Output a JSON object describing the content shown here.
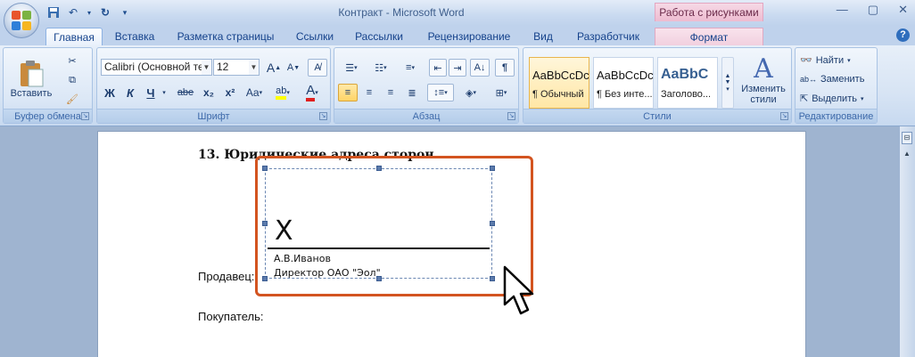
{
  "window": {
    "title": "Контракт - Microsoft Word",
    "contextual_header": "Работа с рисунками"
  },
  "tabs": [
    "Главная",
    "Вставка",
    "Разметка страницы",
    "Ссылки",
    "Рассылки",
    "Рецензирование",
    "Вид",
    "Разработчик",
    "Формат"
  ],
  "ribbon": {
    "clipboard": {
      "paste_label": "Вставить",
      "group_label": "Буфер обмена"
    },
    "font": {
      "font_name": "Calibri (Основной те",
      "font_size": "12",
      "bold": "Ж",
      "italic": "К",
      "underline": "Ч",
      "strike": "abe",
      "subscript": "x₂",
      "superscript": "x²",
      "case": "Aa",
      "grow": "A",
      "shrink": "A",
      "highlight": "ab",
      "font_color": "A",
      "group_label": "Шрифт"
    },
    "paragraph": {
      "group_label": "Абзац",
      "show_marks": "¶"
    },
    "styles": {
      "items": [
        {
          "sample": "AaBbCcDc",
          "name": "¶ Обычный"
        },
        {
          "sample": "AaBbCcDc",
          "name": "¶ Без инте..."
        },
        {
          "sample": "AaBbC",
          "name": "Заголово..."
        }
      ],
      "change_styles": "Изменить стили",
      "group_label": "Стили"
    },
    "editing": {
      "find": "Найти",
      "replace": "Заменить",
      "select": "Выделить",
      "group_label": "Редактирование"
    }
  },
  "document": {
    "heading": "13. Юридические адреса сторон",
    "seller": "Продавец:",
    "buyer": "Покупатель:",
    "signature": {
      "x_mark": "X",
      "name": "А.В.Иванов",
      "title": "Директор ОАО \"Эол\""
    }
  },
  "colors": {
    "highlight_border": "#d35420",
    "accent": "#15428b",
    "contextual": "#eebbd0"
  }
}
